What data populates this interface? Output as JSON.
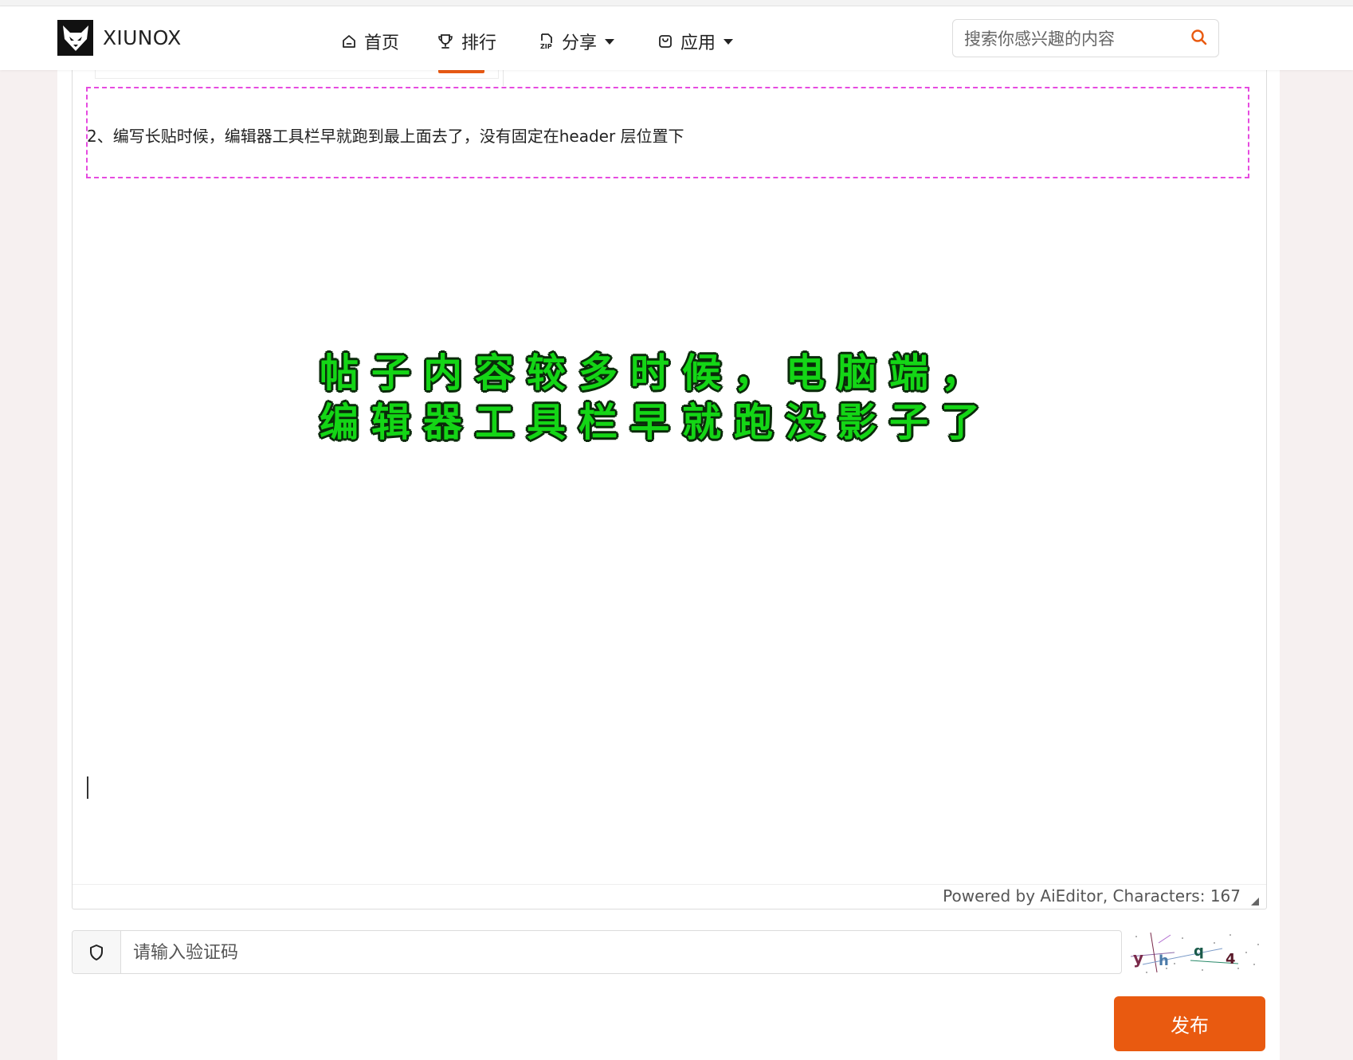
{
  "brand": {
    "name": "XIUNOX"
  },
  "nav": {
    "items": [
      {
        "label": "首页",
        "icon": "home-icon",
        "dropdown": false
      },
      {
        "label": "排行",
        "icon": "trophy-icon",
        "dropdown": false
      },
      {
        "label": "分享",
        "icon": "zip-file-icon",
        "dropdown": true
      },
      {
        "label": "应用",
        "icon": "bag-icon",
        "dropdown": true
      }
    ]
  },
  "search": {
    "placeholder": "搜索你感兴趣的内容",
    "icon": "search-icon"
  },
  "editor": {
    "paragraph": "2、编写长贴时候，编辑器工具栏早就跑到最上面去了，没有固定在header 层位置下",
    "annotation_line1": "帖子内容较多时候，电脑端，",
    "annotation_line2": "编辑器工具栏早就跑没影子了",
    "footer": "Powered by AiEditor, Characters: 167"
  },
  "captcha": {
    "placeholder": "请输入验证码",
    "icon": "shield-icon",
    "image_text": "yhq4"
  },
  "publish": {
    "label": "发布"
  },
  "colors": {
    "accent": "#e95a10",
    "highlight_border": "#e64be0",
    "annotation_text": "#14d616",
    "page_bg": "#f6f0f0"
  }
}
